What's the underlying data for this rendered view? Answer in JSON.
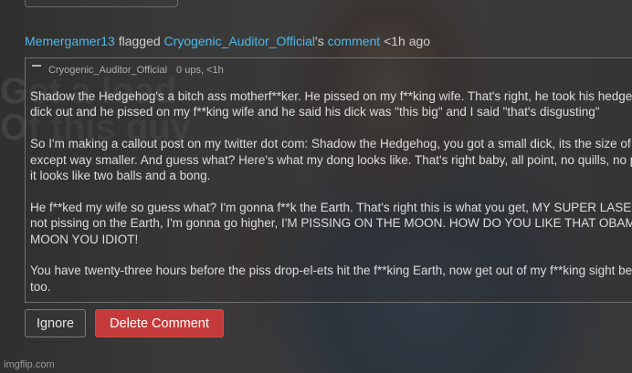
{
  "backdrop": {
    "meme_caption_lines": [
      "Get a load",
      "Of this guy"
    ]
  },
  "flag": {
    "flagger": "Memergamer13",
    "verb": "flagged",
    "target_user": "Cryogenic_Auditor_Official",
    "possessive": "'s",
    "object": "comment",
    "time": "<1h ago"
  },
  "comment": {
    "author": "Cryogenic_Auditor_Official",
    "ups": "0 ups, <1h",
    "paragraphs": [
      [
        "Shadow the Hedgehog's a bitch ass motherf**ker. He pissed on my f**king wife. That's right, he took his hedgehog f**king quilly",
        "dick out and he pissed on my f**king wife and he said his dick was \"this big\" and I said \"that's disgusting\""
      ],
      [
        "So I'm making a callout post on my twitter dot com: Shadow the Hedgehog, you got a small dick, its the size of this walnut",
        "except way smaller. And guess what? Here's what my dong looks like. That's right baby, all point, no quills, no pillows. Look at that,",
        "it looks like two balls and a bong."
      ],
      [
        "He f**ked my wife so guess what? I'm gonna f**k the Earth. That's right this is what you get, MY SUPER LASER PISS! Except I'm",
        "not pissing on the Earth, I'm gonna go higher, I'M PISSING ON THE MOON. HOW DO YOU LIKE THAT OBAMA? I PISSED ON THE",
        "MOON YOU IDIOT!"
      ],
      [
        "You have twenty-three hours before the piss drop-el-ets hit the f**king Earth, now get out of my f**king sight before I piss on you",
        "too."
      ]
    ]
  },
  "actions": {
    "ignore_label": "Ignore",
    "delete_label": "Delete Comment"
  },
  "watermark": "imgflip.com",
  "colors": {
    "link": "#4fb8e8",
    "delete_button": "#c53b3b"
  }
}
